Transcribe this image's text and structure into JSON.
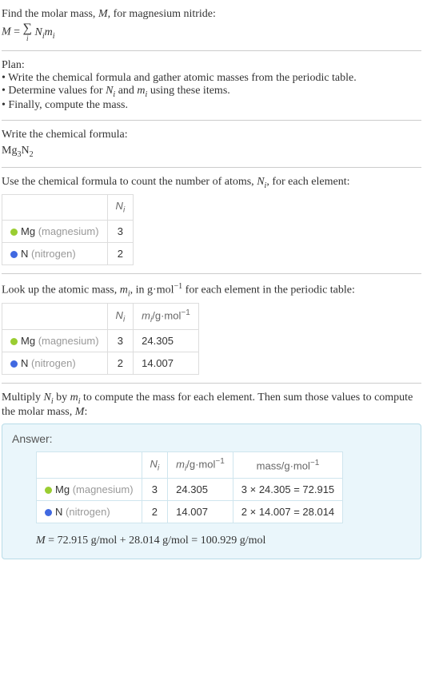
{
  "intro": {
    "line1_pre": "Find the molar mass, ",
    "line1_sym": "M",
    "line1_post": ", for magnesium nitride:",
    "formula_lhs": "M",
    "formula_eq": " = ",
    "formula_rhs_ni": "N",
    "formula_rhs_mi": "m",
    "formula_sub": "i"
  },
  "plan": {
    "heading": "Plan:",
    "item1": "• Write the chemical formula and gather atomic masses from the periodic table.",
    "item2_pre": "• Determine values for ",
    "item2_n": "N",
    "item2_and": " and ",
    "item2_m": "m",
    "item2_sub": "i",
    "item2_post": " using these items.",
    "item3": "• Finally, compute the mass."
  },
  "chemFormula": {
    "heading": "Write the chemical formula:",
    "mg": "Mg",
    "mg_sub": "3",
    "n": "N",
    "n_sub": "2"
  },
  "countAtoms": {
    "text_pre": "Use the chemical formula to count the number of atoms, ",
    "sym": "N",
    "sub": "i",
    "text_post": ", for each element:",
    "hdr_blank": "",
    "hdr_ni": "N",
    "hdr_ni_sub": "i",
    "rows": [
      {
        "swatch": "mg-swatch",
        "sym": "Mg",
        "name": "(magnesium)",
        "n": "3"
      },
      {
        "swatch": "n-swatch",
        "sym": "N",
        "name": "(nitrogen)",
        "n": "2"
      }
    ]
  },
  "atomicMass": {
    "text_pre": "Look up the atomic mass, ",
    "sym": "m",
    "sub": "i",
    "text_mid": ", in g·mol",
    "exp": "−1",
    "text_post": " for each element in the periodic table:",
    "hdr_ni": "N",
    "hdr_mi": "m",
    "hdr_sub": "i",
    "hdr_unit": "/g·mol",
    "hdr_exp": "−1",
    "rows": [
      {
        "swatch": "mg-swatch",
        "sym": "Mg",
        "name": "(magnesium)",
        "n": "3",
        "m": "24.305"
      },
      {
        "swatch": "n-swatch",
        "sym": "N",
        "name": "(nitrogen)",
        "n": "2",
        "m": "14.007"
      }
    ]
  },
  "multiply": {
    "p1": "Multiply ",
    "n": "N",
    "sub": "i",
    "by": " by ",
    "m": "m",
    "p2": " to compute the mass for each element. Then sum those values to compute the molar mass, ",
    "Msym": "M",
    "p3": ":"
  },
  "answer": {
    "label": "Answer:",
    "hdr_ni": "N",
    "hdr_mi": "m",
    "hdr_sub": "i",
    "hdr_unit": "/g·mol",
    "hdr_exp": "−1",
    "hdr_mass": "mass/g·mol",
    "rows": [
      {
        "swatch": "mg-swatch",
        "sym": "Mg",
        "name": "(magnesium)",
        "n": "3",
        "m": "24.305",
        "calc": "3 × 24.305 = 72.915"
      },
      {
        "swatch": "n-swatch",
        "sym": "N",
        "name": "(nitrogen)",
        "n": "2",
        "m": "14.007",
        "calc": "2 × 14.007 = 28.014"
      }
    ],
    "final_lhs": "M",
    "final_eq": " = 72.915 g/mol + 28.014 g/mol = 100.929 g/mol"
  }
}
